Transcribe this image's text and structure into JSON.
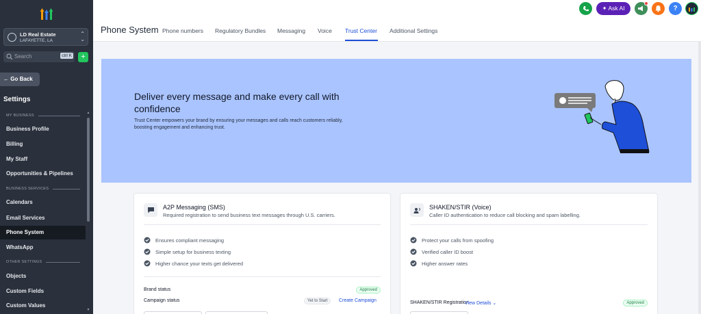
{
  "sidebar": {
    "account": {
      "name": "LD Real Estate",
      "location": "LAFAYETTE, LA"
    },
    "search": {
      "placeholder": "Search",
      "shortcut": "ctrl K"
    },
    "go_back": "Go Back",
    "settings_title": "Settings",
    "sections": {
      "my_business": "MY BUSINESS",
      "business_services": "BUSINESS SERVICES",
      "other_settings": "OTHER SETTINGS"
    },
    "items": [
      {
        "label": "Business Profile"
      },
      {
        "label": "Billing"
      },
      {
        "label": "My Staff"
      },
      {
        "label": "Opportunities & Pipelines"
      },
      {
        "label": "Calendars"
      },
      {
        "label": "Email Services"
      },
      {
        "label": "Phone System",
        "active": true
      },
      {
        "label": "WhatsApp"
      },
      {
        "label": "Objects"
      },
      {
        "label": "Custom Fields"
      },
      {
        "label": "Custom Values"
      }
    ]
  },
  "topbar": {
    "ask_ai": "Ask AI",
    "help": "?",
    "colors": {
      "phone": "#16a34a",
      "ask_ai": "#5b21b6",
      "megaphone": "#3f8f5a",
      "bell": "#f97316",
      "help": "#3b82f6",
      "avatar": "#1f2937"
    }
  },
  "page": {
    "title": "Phone System",
    "tabs": [
      {
        "label": "Phone numbers"
      },
      {
        "label": "Regulatory Bundles"
      },
      {
        "label": "Messaging"
      },
      {
        "label": "Voice"
      },
      {
        "label": "Trust Center",
        "active": true
      },
      {
        "label": "Additional Settings"
      }
    ]
  },
  "hero": {
    "title": "Deliver every message and make every call with confidence",
    "subtitle": "Trust Center empowers your brand by ensuring your messages and calls reach customers reliably, boosting engagement and enhancing trust."
  },
  "a2p": {
    "title": "A2P Messaging (SMS)",
    "subtitle": "Required registration to send business text messages through U.S. carriers.",
    "features": [
      "Ensures compliant messaging",
      "Simple setup for business texting",
      "Higher chance your texts get delivered"
    ],
    "brand_status_label": "Brand status",
    "brand_status": "Approved",
    "campaign_status_label": "Campaign status",
    "campaign_status": "Yet to Start",
    "create_campaign": "Create Campaign"
  },
  "shaken": {
    "title": "SHAKEN/STIR (Voice)",
    "subtitle": "Caller ID authentication to reduce call blocking and spam labelling.",
    "features": [
      "Protect your calls from spoofing",
      "Verified caller ID boost",
      "Higher answer rates"
    ],
    "registration_label": "SHAKEN/STIR Registration",
    "view_details": "View Details",
    "registration_status": "Approved"
  }
}
